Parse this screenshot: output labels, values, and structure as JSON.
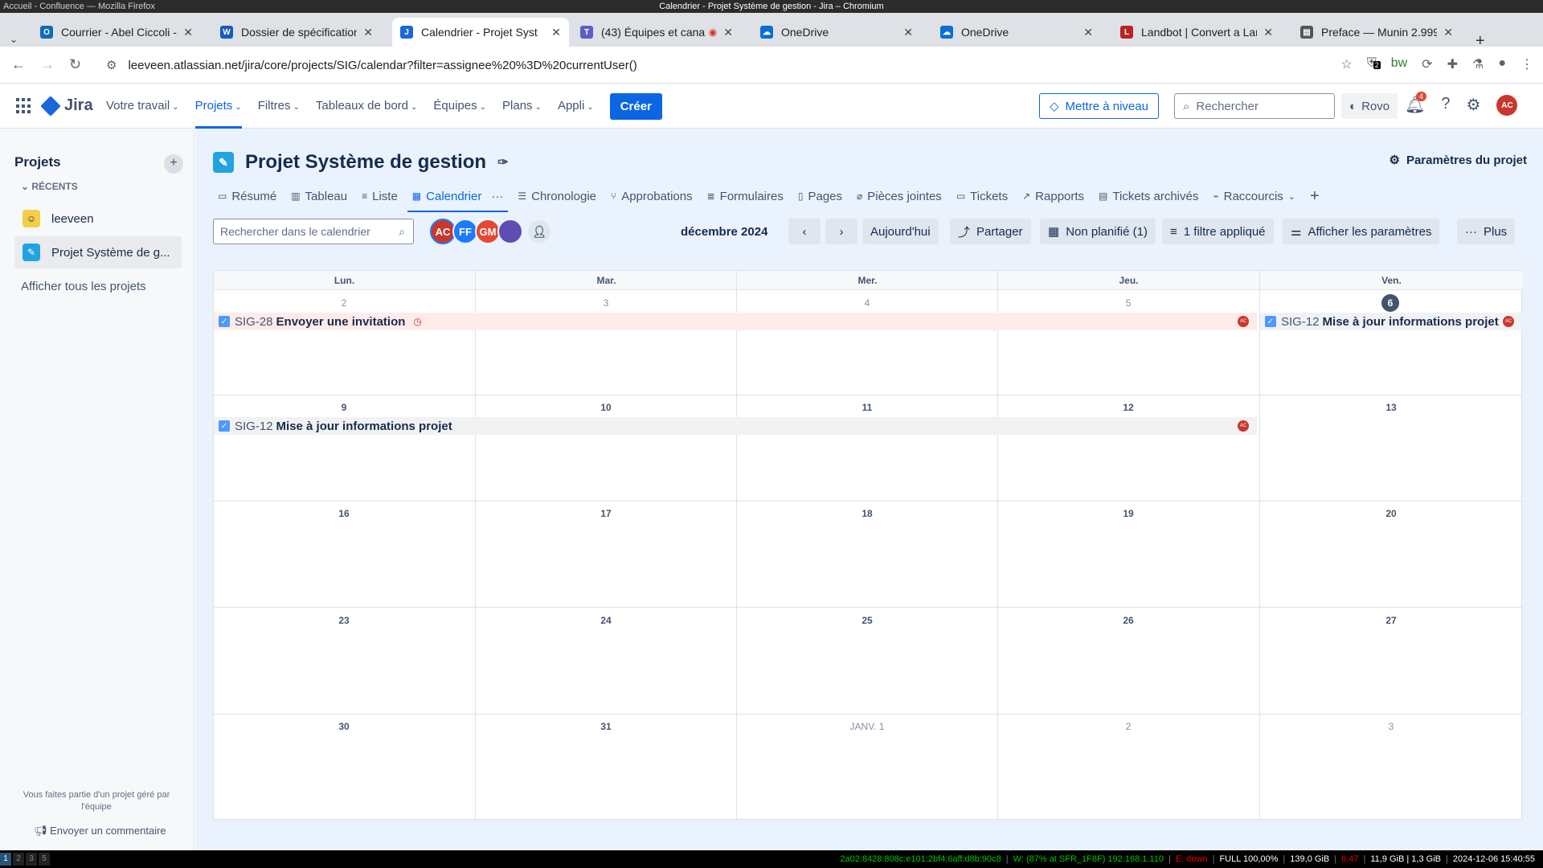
{
  "os": {
    "left_title": "Accueil - Confluence — Mozilla Firefox",
    "center_title": "Calendrier - Projet Système de gestion - Jira – Chromium"
  },
  "tabs": [
    {
      "label": "Courrier - Abel Ciccoli - ",
      "icon": "outlook-icon",
      "color": "#0f6cbd",
      "glyph": "O"
    },
    {
      "label": "Dossier de spécification",
      "icon": "word-icon",
      "color": "#185abd",
      "glyph": "W"
    },
    {
      "label": "Calendrier - Projet Syst",
      "icon": "jira-icon",
      "color": "#1868db",
      "glyph": "J"
    },
    {
      "label": "(43) Équipes et cana",
      "icon": "teams-icon",
      "color": "#5b5fc7",
      "glyph": "T"
    },
    {
      "label": "OneDrive",
      "icon": "onedrive-icon",
      "color": "#0a6fd6",
      "glyph": "☁"
    },
    {
      "label": "OneDrive",
      "icon": "onedrive-icon",
      "color": "#0a6fd6",
      "glyph": "☁"
    },
    {
      "label": "Landbot | Convert a Lar",
      "icon": "landbot-icon",
      "color": "#b22",
      "glyph": "L"
    },
    {
      "label": "Preface — Munin 2.999.",
      "icon": "doc-icon",
      "color": "#555",
      "glyph": "▤"
    }
  ],
  "address": {
    "url": "leeveen.atlassian.net/jira/core/projects/SIG/calendar?filter=assignee%20%3D%20currentUser()"
  },
  "ext_badge": "2",
  "jira": {
    "logo": "Jira",
    "menu": [
      {
        "label": "Votre travail"
      },
      {
        "label": "Projets"
      },
      {
        "label": "Filtres"
      },
      {
        "label": "Tableaux de bord"
      },
      {
        "label": "Équipes"
      },
      {
        "label": "Plans"
      },
      {
        "label": "Appli"
      }
    ],
    "create": "Créer",
    "upgrade": "Mettre à niveau",
    "search_placeholder": "Rechercher",
    "rovo": "Rovo",
    "notif_count": "4",
    "user_initials": "AC"
  },
  "sidebar": {
    "title": "Projets",
    "recent": "RÉCENTS",
    "items": [
      {
        "label": "leeveen"
      },
      {
        "label": "Projet Système de g..."
      }
    ],
    "all_projects": "Afficher tous les projets",
    "footer": "Vous faites partie d'un projet géré par l'équipe",
    "feedback": "Envoyer un commentaire"
  },
  "project": {
    "title": "Projet Système de gestion",
    "settings": "Paramètres du projet",
    "tabs": [
      {
        "label": "Résumé",
        "icon": "▭"
      },
      {
        "label": "Tableau",
        "icon": "▥"
      },
      {
        "label": "Liste",
        "icon": "≡"
      },
      {
        "label": "Calendrier",
        "icon": "▦"
      },
      {
        "label": "Chronologie",
        "icon": "☰"
      },
      {
        "label": "Approbations",
        "icon": "⑂"
      },
      {
        "label": "Formulaires",
        "icon": "≣"
      },
      {
        "label": "Pages",
        "icon": "▯"
      },
      {
        "label": "Pièces jointes",
        "icon": "⌀"
      },
      {
        "label": "Tickets",
        "icon": "▭"
      },
      {
        "label": "Rapports",
        "icon": "↗"
      },
      {
        "label": "Tickets archivés",
        "icon": "▤"
      },
      {
        "label": "Raccourcis",
        "icon": "⌁"
      }
    ]
  },
  "calendar": {
    "search_placeholder": "Rechercher dans le calendrier",
    "avatars": [
      {
        "initials": "AC",
        "color": "#c9372c"
      },
      {
        "initials": "FF",
        "color": "#1d7afc"
      },
      {
        "initials": "GM",
        "color": "#e34935"
      },
      {
        "initials": "",
        "color": "#5e4db2"
      }
    ],
    "month": "décembre 2024",
    "today_btn": "Aujourd'hui",
    "share_btn": "Partager",
    "unplanned_btn": "Non planifié (1)",
    "filter_btn": "1 filtre appliqué",
    "settings_btn": "Afficher les paramètres",
    "more_btn": "Plus",
    "day_headers": [
      "Lun.",
      "Mar.",
      "Mer.",
      "Jeu.",
      "Ven."
    ],
    "weeks": [
      [
        "2",
        "3",
        "4",
        "5",
        "6"
      ],
      [
        "9",
        "10",
        "11",
        "12",
        "13"
      ],
      [
        "16",
        "17",
        "18",
        "19",
        "20"
      ],
      [
        "23",
        "24",
        "25",
        "26",
        "27"
      ],
      [
        "30",
        "31",
        "JANV. 1",
        "2",
        "3"
      ]
    ],
    "events": [
      {
        "key": "SIG-28",
        "summary": "Envoyer une invitation",
        "assignee": "AC"
      },
      {
        "key": "SIG-12",
        "summary": "Mise à jour informations projet",
        "assignee": "AC"
      },
      {
        "key": "SIG-12",
        "summary": "Mise à jour informations projet",
        "assignee": "AC"
      }
    ]
  },
  "statusbar": {
    "workspaces": [
      "1",
      "2",
      "3",
      "5"
    ],
    "ipv6": "2a02:8428:808c:e101:2bf4:6aff:d8b:90c8",
    "wifi": "W: (87% at SFR_1F8F) 192.168.1.110",
    "eth": "E: down",
    "battery": "FULL 100,00%",
    "disk": "139,0 GiB",
    "load": "6,47",
    "mem": "11,9 GiB | 1,3 GiB",
    "clock": "2024-12-06 15:40:55"
  }
}
